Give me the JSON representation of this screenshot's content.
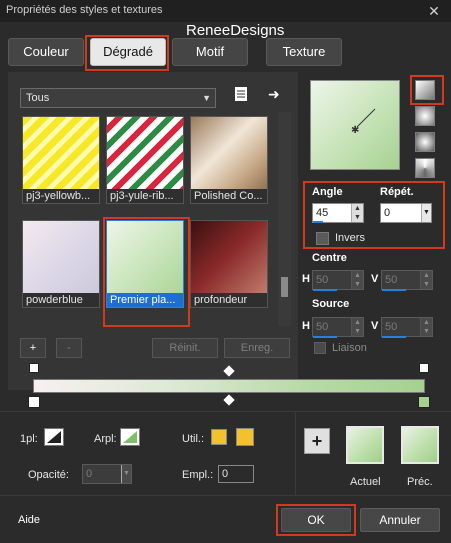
{
  "window": {
    "title": "Propriétés des styles et textures",
    "watermark": "ReneeDesigns",
    "close": "✕"
  },
  "tabs": [
    {
      "label": "Couleur"
    },
    {
      "label": "Dégradé",
      "active": true
    },
    {
      "label": "Motif"
    },
    {
      "label": "Texture"
    }
  ],
  "category": {
    "selected": "Tous"
  },
  "thumbnails": [
    {
      "label": "pj3-yellowb...",
      "selected": false
    },
    {
      "label": "pj3-yule-rib...",
      "selected": false
    },
    {
      "label": "Polished Co...",
      "selected": false
    },
    {
      "label": "powderblue",
      "selected": false
    },
    {
      "label": "Premier pla...",
      "selected": true
    },
    {
      "label": "profondeur",
      "selected": false
    }
  ],
  "list_buttons": {
    "add": "+",
    "remove": "-",
    "reset": "Réinit.",
    "save": "Enreg."
  },
  "angle": {
    "label": "Angle",
    "value": "45"
  },
  "repeat": {
    "label": "Répét.",
    "value": "0"
  },
  "invert": {
    "label": "Invers",
    "checked": false
  },
  "center": {
    "label": "Centre",
    "h_label": "H",
    "h_value": "50",
    "v_label": "V",
    "v_value": "50"
  },
  "source": {
    "label": "Source",
    "h_label": "H",
    "h_value": "50",
    "v_label": "V",
    "v_value": "50"
  },
  "link": {
    "label": "Liaison",
    "checked": false
  },
  "stops": {
    "fg_label": "1pl:",
    "bg_label": "Arpl:",
    "util_label": "Util.:",
    "opacity_label": "Opacité:",
    "opacity_value": "0",
    "location_label": "Empl.:",
    "location_value": "0",
    "util_color": "#f2c12e"
  },
  "previews": {
    "add": "+",
    "current_label": "Actuel",
    "previous_label": "Préc."
  },
  "footer": {
    "help": "Aide",
    "ok": "OK",
    "cancel": "Annuler"
  },
  "colors": {
    "highlight": "#d23a1e",
    "selection": "#1f6fd0",
    "gradient_start": "#f7f0f0",
    "gradient_end": "#a5d28f"
  }
}
